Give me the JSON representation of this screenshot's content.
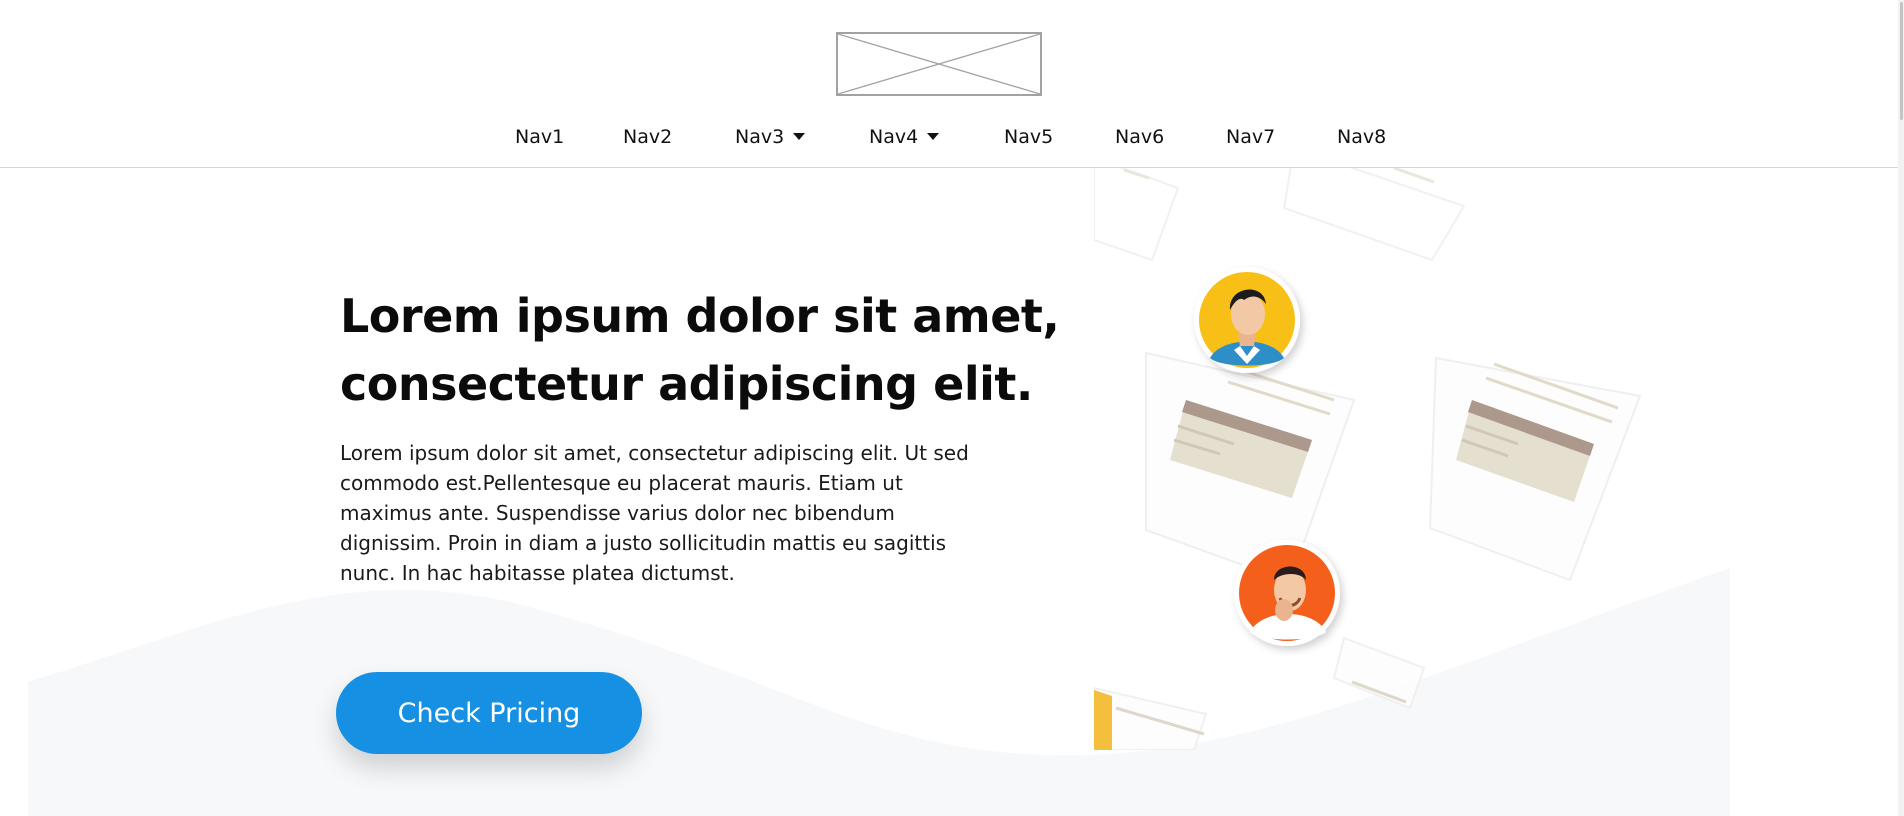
{
  "header": {
    "logo": {
      "alt": "placeholder-logo"
    },
    "nav": [
      {
        "label": "Nav1",
        "dropdown": false
      },
      {
        "label": "Nav2",
        "dropdown": false
      },
      {
        "label": "Nav3",
        "dropdown": true
      },
      {
        "label": "Nav4",
        "dropdown": true
      },
      {
        "label": "Nav5",
        "dropdown": false
      },
      {
        "label": "Nav6",
        "dropdown": false
      },
      {
        "label": "Nav7",
        "dropdown": false
      },
      {
        "label": "Nav8",
        "dropdown": false
      }
    ]
  },
  "hero": {
    "title_line1": "Lorem ipsum dolor sit amet,",
    "title_line2": "consectetur adipiscing elit.",
    "description": "Lorem ipsum dolor sit amet, consectetur adipiscing elit. Ut sed commodo est.Pellentesque eu placerat mauris. Etiam ut maximus ante. Suspendisse varius dolor nec bibendum dignissim. Proin in diam a justo sollicitudin mattis eu sagittis nunc. In hac habitasse platea dictumst.",
    "cta_label": "Check Pricing"
  },
  "colors": {
    "accent": "#1690e3",
    "wave": "#f7f8fa",
    "avatar_yellow": "#f8c012",
    "avatar_orange": "#f55e1b",
    "divider": "#d6d6d6"
  },
  "icons": {
    "logo": "placeholder-image-icon",
    "dropdown": "caret-down-icon",
    "avatar_1": "user-avatar-icon",
    "avatar_2": "user-avatar-icon"
  }
}
